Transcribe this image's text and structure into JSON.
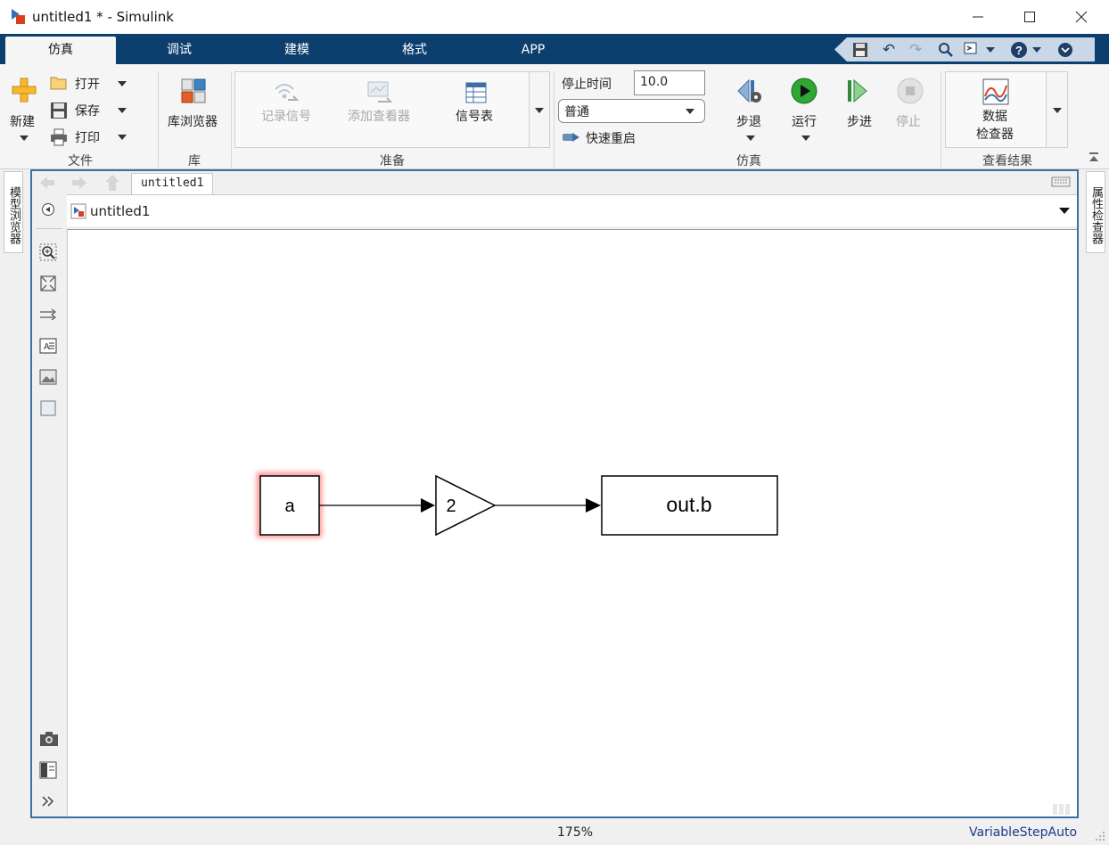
{
  "window": {
    "title": "untitled1 * - Simulink"
  },
  "tabs": [
    {
      "label": "仿真",
      "active": true
    },
    {
      "label": "调试",
      "active": false
    },
    {
      "label": "建模",
      "active": false
    },
    {
      "label": "格式",
      "active": false
    },
    {
      "label": "APP",
      "active": false
    }
  ],
  "ribbon": {
    "file": {
      "new_label": "新建",
      "open_label": "打开",
      "save_label": "保存",
      "print_label": "打印",
      "group_label": "文件"
    },
    "library": {
      "browser_label": "库浏览器",
      "group_label": "库"
    },
    "prepare": {
      "log_signals_label": "记录信号",
      "add_viewer_label": "添加查看器",
      "signal_table_label": "信号表",
      "group_label": "准备"
    },
    "simulate": {
      "stop_time_label": "停止时间",
      "stop_time_value": "10.0",
      "mode_value": "普通",
      "fast_restart_label": "快速重启",
      "step_back_label": "步退",
      "run_label": "运行",
      "step_forward_label": "步进",
      "stop_label": "停止",
      "group_label": "仿真"
    },
    "review": {
      "data_inspector_label_1": "数据",
      "data_inspector_label_2": "检查器",
      "group_label": "查看结果"
    }
  },
  "side_tabs": {
    "left": "模型浏览器",
    "right": "属性检查器"
  },
  "editor": {
    "tab_label": "untitled1",
    "breadcrumb_label": "untitled1"
  },
  "diagram": {
    "blocks": [
      {
        "name": "a",
        "label": "a"
      },
      {
        "name": "gain",
        "label": "2"
      },
      {
        "name": "out",
        "label": "out.b"
      }
    ]
  },
  "status": {
    "zoom": "175%",
    "solver": "VariableStepAuto"
  },
  "colors": {
    "tab_bar": "#0d3f6e",
    "editor_border": "#3d6fa6",
    "selection_glow": "#ff2a2a",
    "solver_text": "#1b3a8c"
  }
}
